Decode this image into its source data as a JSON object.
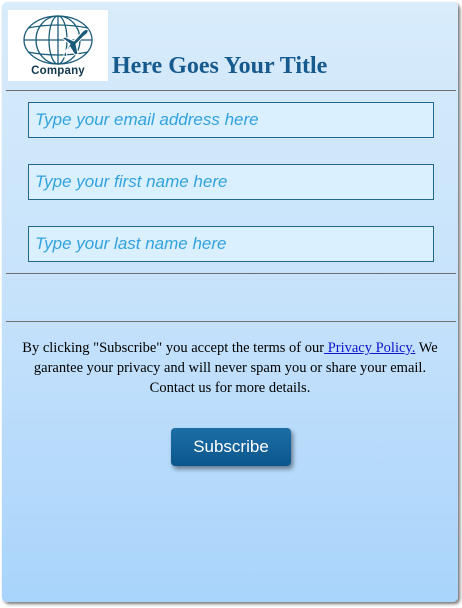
{
  "header": {
    "logo": {
      "icon": "globe-airplane-icon",
      "text": "Company"
    },
    "title": "Here Goes Your Title"
  },
  "form": {
    "email_placeholder": "Type your email address here",
    "first_name_placeholder": "Type your first name here",
    "last_name_placeholder": "Type your last name here",
    "email_value": "",
    "first_name_value": "",
    "last_name_value": ""
  },
  "terms": {
    "text_before": "By clicking \"Subscribe\" you accept the terms of our",
    "link_text": " Privacy Policy.",
    "text_after": " We garantee your privacy and will never spam you or share your email. Contact us for more details."
  },
  "subscribe_label": "Subscribe",
  "colors": {
    "title": "#175a8e",
    "button": "#0b568d",
    "field_border": "#21678f",
    "placeholder": "#32a2dd",
    "link": "#1313cc"
  }
}
